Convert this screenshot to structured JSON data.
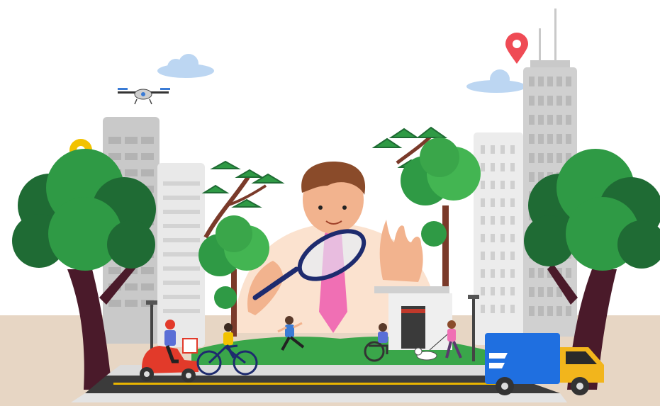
{
  "scene": {
    "description_visible_text": "",
    "colors": {
      "sky": "#ffffff",
      "ground": "#e7d6c4",
      "building_light": "#eeeeee",
      "building_gray": "#c9c9c9",
      "window": "#b9b9b9",
      "tree_dark": "#1f6b34",
      "tree_mid": "#2f9a45",
      "tree_light": "#43b552",
      "trunk": "#4a1a2a",
      "road": "#3b3b3b",
      "road_line": "#e8b400",
      "sidewalk": "#dcdcdc",
      "grass": "#3aa64a",
      "skin": "#f2b38e",
      "shirt": "#fbe2cf",
      "tie": "#f06fb4",
      "hair": "#8a4b2a",
      "magnifier": "#1e2b6e",
      "pin_red": "#ef4b55",
      "pin_yellow": "#f2c200",
      "cloud": "#bcd6f2",
      "truck_blue": "#1f6fe0",
      "truck_yellow": "#f2b51c",
      "scooter_red": "#e23a2a"
    },
    "icons": [
      "drone-icon",
      "location-pin-red-icon",
      "location-pin-yellow-icon",
      "cloud-icon"
    ]
  }
}
